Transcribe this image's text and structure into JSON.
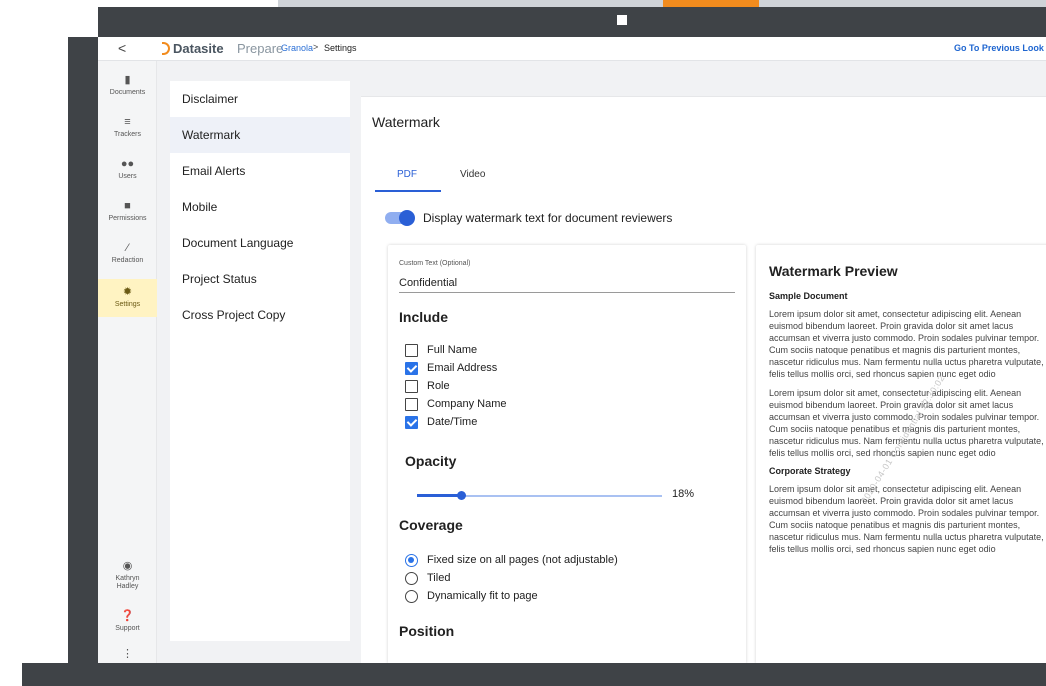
{
  "topbar": {
    "back_glyph": "<",
    "brand_name": "Datasite",
    "brand_product": "Prepare",
    "breadcrumb_project": "Granola",
    "breadcrumb_separator": ">",
    "breadcrumb_current": "Settings",
    "previous_look_label": "Go To Previous Look"
  },
  "leftnav": {
    "items": [
      {
        "label": "Documents",
        "icon": "document-icon"
      },
      {
        "label": "Trackers",
        "icon": "tracker-list-icon"
      },
      {
        "label": "Users",
        "icon": "users-icon"
      },
      {
        "label": "Permissions",
        "icon": "lock-icon"
      },
      {
        "label": "Redaction",
        "icon": "pen-icon"
      },
      {
        "label": "Settings",
        "icon": "gear-icon",
        "active": true
      }
    ],
    "bottom": [
      {
        "label": "Kathryn Hadley",
        "icon": "user-circle-icon"
      },
      {
        "label": "Support",
        "icon": "help-icon"
      }
    ],
    "more_glyph": "⋮"
  },
  "settings_menu": {
    "items": [
      {
        "label": "Disclaimer"
      },
      {
        "label": "Watermark",
        "active": true
      },
      {
        "label": "Email Alerts"
      },
      {
        "label": "Mobile"
      },
      {
        "label": "Document Language"
      },
      {
        "label": "Project Status"
      },
      {
        "label": "Cross Project Copy"
      }
    ]
  },
  "watermark": {
    "title": "Watermark",
    "tabs": [
      {
        "label": "PDF",
        "active": true
      },
      {
        "label": "Video"
      }
    ],
    "toggle_label": "Display watermark text for document reviewers",
    "toggle_on": true,
    "custom_text_label": "Custom Text (Optional)",
    "custom_text_value": "Confidential",
    "include_heading": "Include",
    "include_options": [
      {
        "label": "Full Name",
        "checked": false
      },
      {
        "label": "Email Address",
        "checked": true
      },
      {
        "label": "Role",
        "checked": false
      },
      {
        "label": "Company Name",
        "checked": false
      },
      {
        "label": "Date/Time",
        "checked": true
      }
    ],
    "opacity_heading": "Opacity",
    "opacity_percent": 18,
    "opacity_label": "18%",
    "coverage_heading": "Coverage",
    "coverage_options": [
      {
        "label": "Fixed size on all pages (not adjustable)",
        "selected": true
      },
      {
        "label": "Tiled",
        "selected": false
      },
      {
        "label": "Dynamically fit to page",
        "selected": false
      }
    ],
    "position_heading": "Position"
  },
  "preview": {
    "title": "Watermark Preview",
    "sample_heading": "Sample Document",
    "para1": "Lorem ipsum dolor sit amet, consectetur adipiscing elit. Aenean euismod bibendum laoreet. Proin gravida dolor sit amet lacus accumsan et viverra justo commodo. Proin sodales pulvinar tempor. Cum sociis natoque penatibus et magnis dis parturient montes, nascetur ridiculus mus. Nam fermentu nulla uctus pharetra vulputate, felis tellus mollis orci, sed rhoncus sapien nunc eget odio",
    "para2": "Lorem ipsum dolor sit amet, consectetur adipiscing elit. Aenean euismod bibendum laoreet. Proin gravida dolor sit amet lacus accumsan et viverra justo commodo. Proin sodales pulvinar tempor. Cum sociis natoque penatibus et magnis dis parturient montes, nascetur ridiculus mus. Nam fermentu nulla uctus pharetra vulputate, felis tellus mollis orci, sed rhoncus sapien nunc eget odio",
    "strategy_heading": "Corporate Strategy",
    "para3": "Lorem ipsum dolor sit amet, consectetur adipiscing elit. Aenean euismod bibendum laoreet. Proin gravida dolor sit amet lacus accumsan et viverra justo commodo. Proin sodales pulvinar tempor. Cum sociis natoque penatibus et magnis dis parturient montes, nascetur ridiculus mus. Nam fermentu nulla uctus pharetra vulputate, felis tellus mollis orci, sed rhoncus sapien nunc eget odio",
    "watermark_text": "2020-04-01 Confidential 12:30:02"
  },
  "colors": {
    "accent": "#2a5fd6",
    "brand_orange": "#f28c1e",
    "active_nav": "#fff3c2",
    "frame": "#3f4347"
  }
}
